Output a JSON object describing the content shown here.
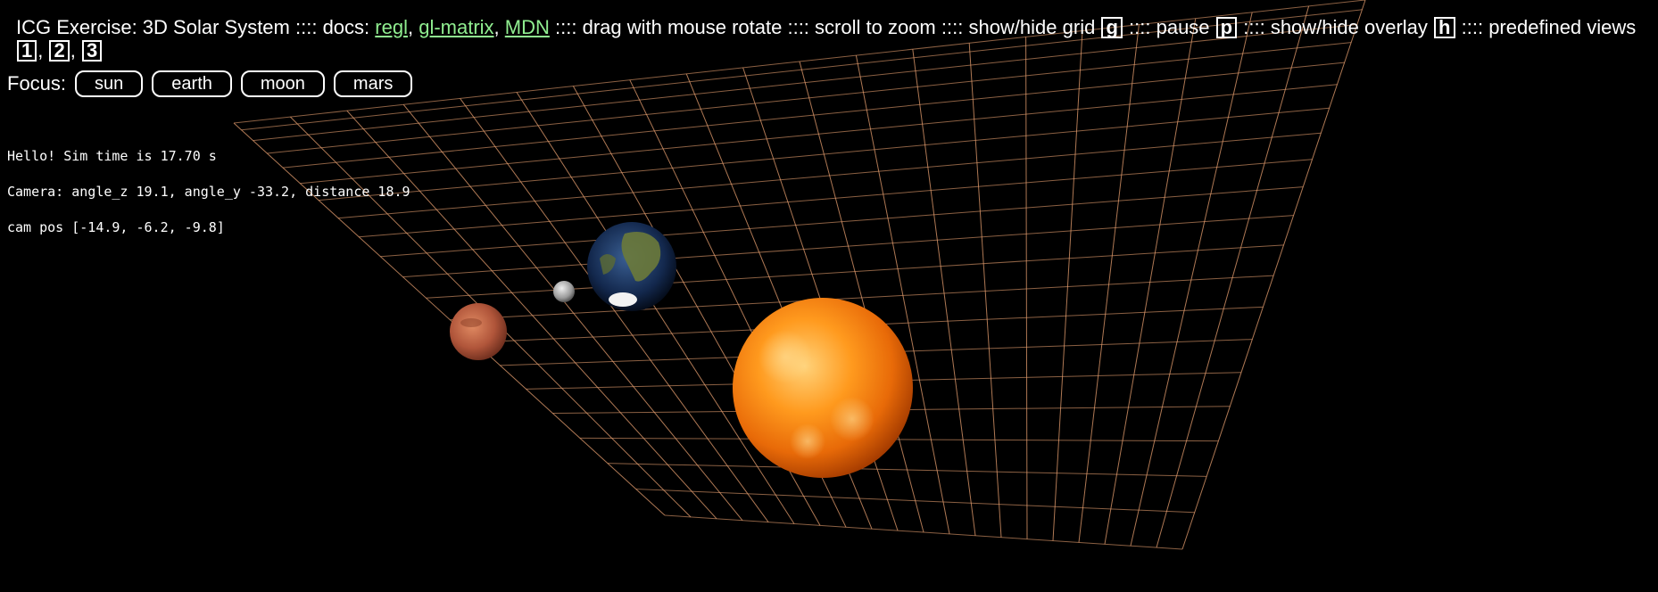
{
  "header": {
    "title": "ICG Exercise: 3D Solar System",
    "sep": " :::: ",
    "docs_label": "docs:",
    "links": [
      "regl",
      "gl-matrix",
      "MDN"
    ],
    "drag_text": "drag with mouse rotate",
    "scroll_text": "scroll to zoom",
    "grid_text": "show/hide grid",
    "grid_key": "g",
    "pause_text": "pause",
    "pause_key": "p",
    "overlay_text": "show/hide overlay",
    "overlay_key": "h",
    "views_text": "predefined views",
    "view_keys": [
      "1",
      "2",
      "3"
    ]
  },
  "focus": {
    "label": "Focus:",
    "buttons": [
      "sun",
      "earth",
      "moon",
      "mars"
    ]
  },
  "overlay": {
    "line1": "Hello! Sim time is 17.70 s",
    "line2": "Camera: angle_z 19.1, angle_y -33.2, distance 18.9",
    "line3": "cam pos [-14.9, -6.2, -9.8]"
  },
  "scene": {
    "grid_color": "#e8a070",
    "bodies": [
      "sun",
      "earth",
      "moon",
      "mars"
    ]
  }
}
